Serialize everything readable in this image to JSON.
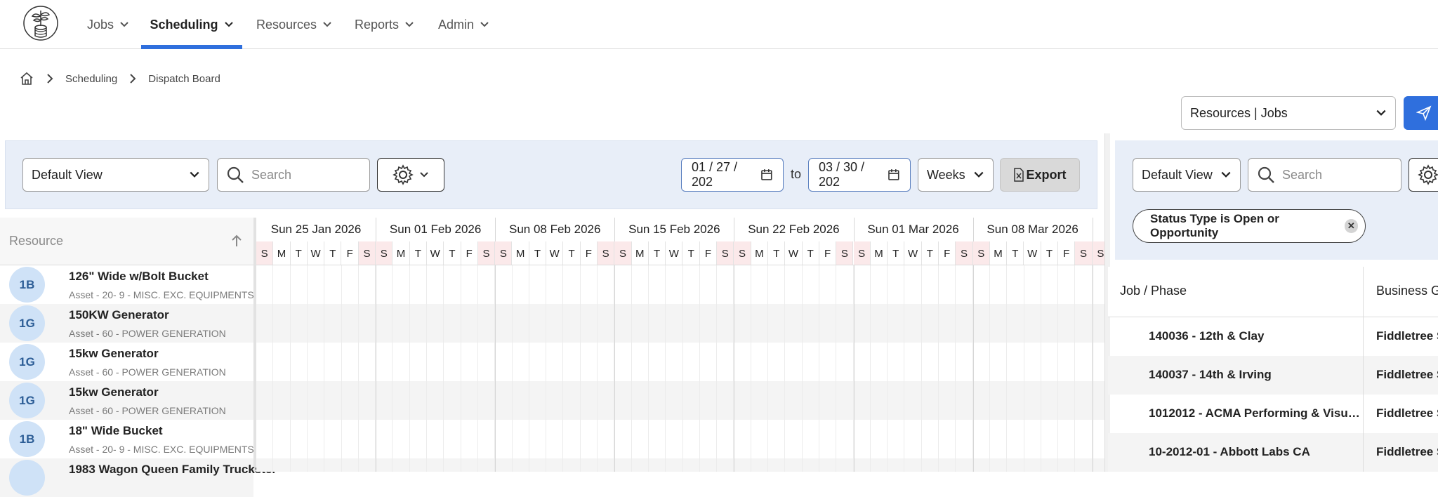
{
  "nav": {
    "items": [
      {
        "label": "Jobs"
      },
      {
        "label": "Scheduling"
      },
      {
        "label": "Resources"
      },
      {
        "label": "Reports"
      },
      {
        "label": "Admin"
      }
    ],
    "active": "Scheduling"
  },
  "breadcrumb": {
    "items": [
      "Scheduling",
      "Dispatch Board"
    ]
  },
  "view_switch": {
    "label": "Resources | Jobs"
  },
  "left_toolbar": {
    "view_label": "Default View",
    "search_placeholder": "Search",
    "date_from": "01 / 27 / 202",
    "to_label": "to",
    "date_to": "03 / 30 / 202",
    "period_label": "Weeks",
    "export_label": "Export"
  },
  "right_toolbar": {
    "view_label": "Default View",
    "search_placeholder": "Search",
    "filter_chip": "Status Type is Open or Opportunity"
  },
  "gantt": {
    "resource_header": "Resource",
    "weeks": [
      "Sun 25 Jan 2026",
      "Sun 01 Feb 2026",
      "Sun 08 Feb 2026",
      "Sun 15 Feb 2026",
      "Sun 22 Feb 2026",
      "Sun 01 Mar 2026",
      "Sun 08 Mar 2026"
    ],
    "day_letters": [
      "S",
      "M",
      "T",
      "W",
      "T",
      "F",
      "S"
    ],
    "resources": [
      {
        "initials": "1B",
        "name": "126\" Wide w/Bolt Bucket",
        "sub": "Asset - 20- 9 - MISC. EXC. EQUIPMENTS"
      },
      {
        "initials": "1G",
        "name": "150KW Generator",
        "sub": "Asset - 60 - POWER GENERATION"
      },
      {
        "initials": "1G",
        "name": "15kw Generator",
        "sub": "Asset - 60 - POWER GENERATION"
      },
      {
        "initials": "1G",
        "name": "15kw Generator",
        "sub": "Asset - 60 - POWER GENERATION"
      },
      {
        "initials": "1B",
        "name": "18\" Wide Bucket",
        "sub": "Asset - 20- 9 - MISC. EXC. EQUIPMENTS"
      },
      {
        "initials": "",
        "name": "1983 Wagon Queen Family Truckster",
        "sub": ""
      }
    ]
  },
  "jobs_table": {
    "col_job": "Job / Phase",
    "col_business": "Business Gr",
    "rows": [
      {
        "job": "140036 - 12th & Clay",
        "business": "Fiddletree S"
      },
      {
        "job": "140037 - 14th & Irving",
        "business": "Fiddletree S"
      },
      {
        "job": "1012012 - ACMA Performing & Visu…",
        "business": "Fiddletree S"
      },
      {
        "job": "10-2012-01 - Abbott Labs CA",
        "business": "Fiddletree S"
      }
    ]
  },
  "colors": {
    "accent": "#2f6fdd",
    "panel": "#e8eef8",
    "weekend": "#fbe9ea",
    "avatar_bg": "#cfe2f7"
  }
}
